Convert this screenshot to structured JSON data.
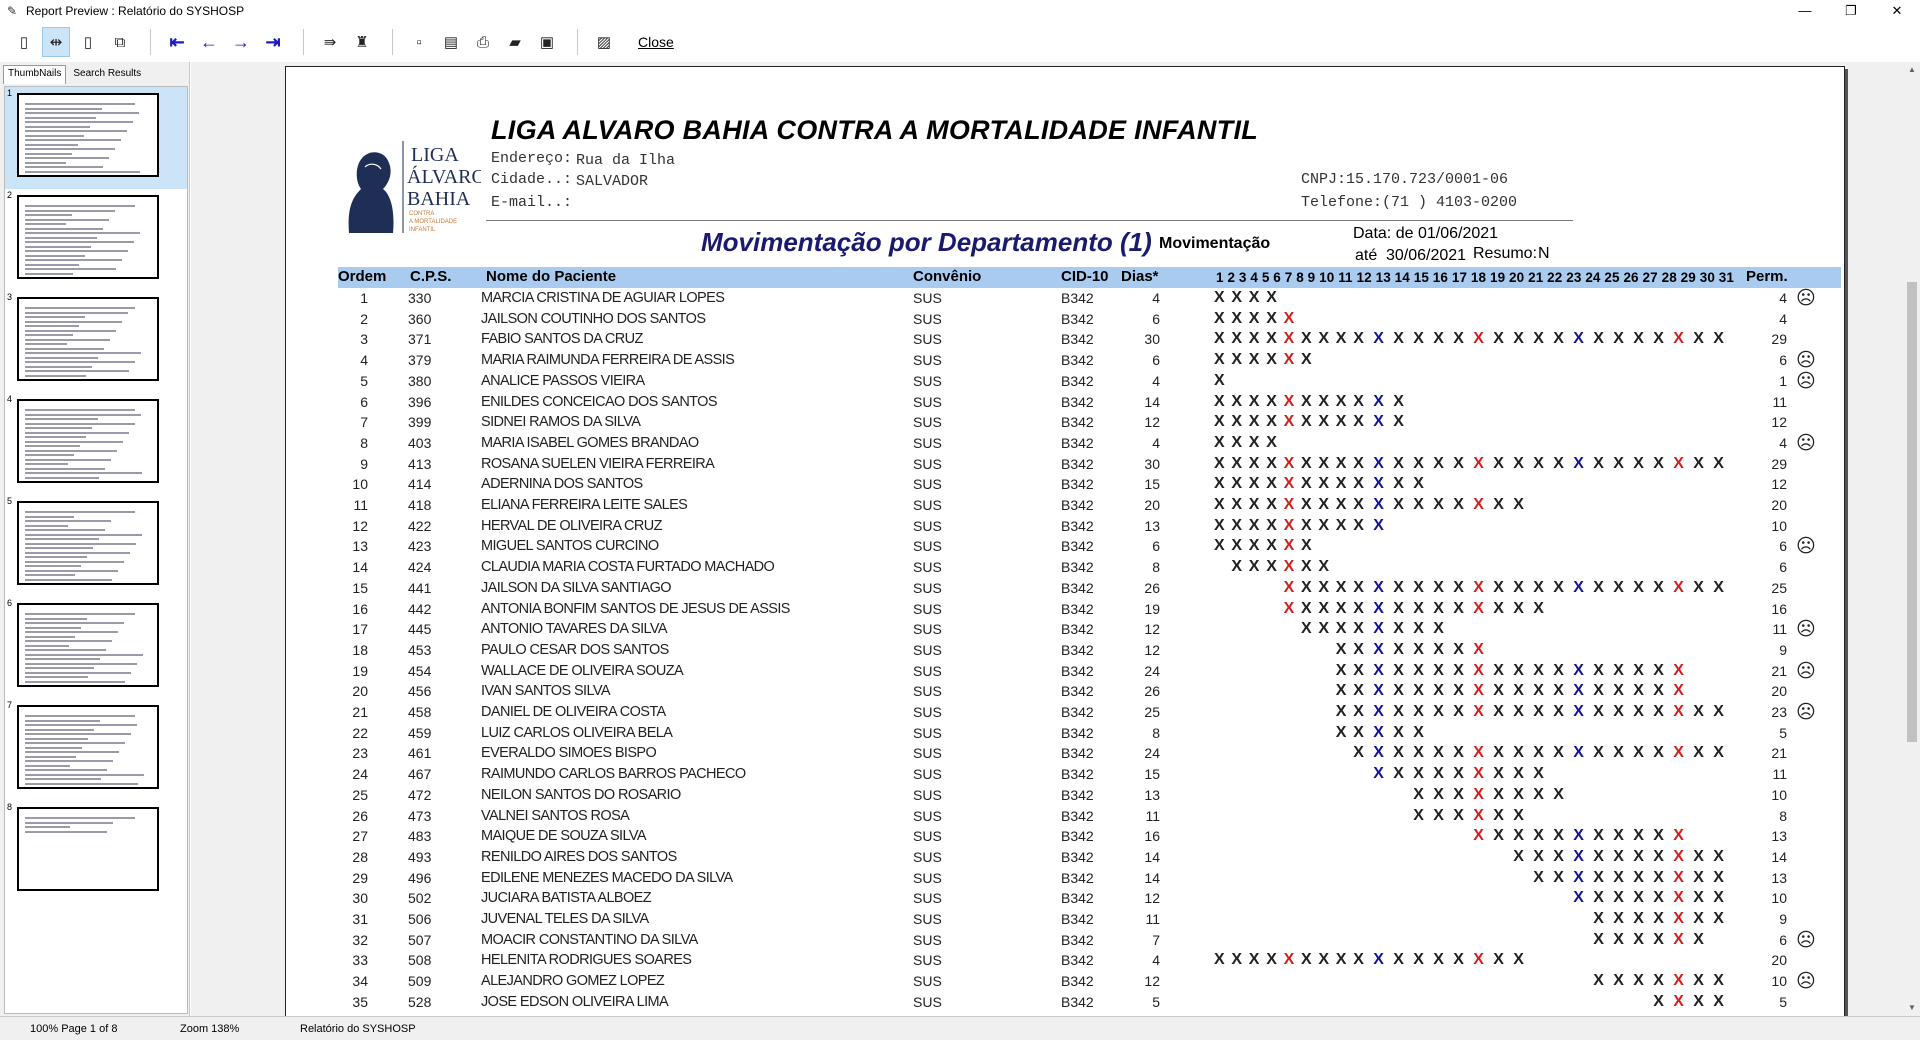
{
  "window": {
    "title": "Report Preview : Relatório do SYSHOSP",
    "controls": [
      "—",
      "❐",
      "✕"
    ]
  },
  "toolbar": {
    "close_label": "Close"
  },
  "left_panel": {
    "tabs": [
      "ThumbNails",
      "Search Results"
    ],
    "thumbnails": [
      "1",
      "2",
      "3",
      "4",
      "5",
      "6",
      "7",
      "8"
    ]
  },
  "report": {
    "org_name": "LIGA ALVARO BAHIA CONTRA A MORTALIDADE INFANTIL",
    "logo_text": [
      "LIGA",
      "ÁLVARO",
      "BAHIA",
      "CONTRA",
      "A MORTALIDADE",
      "INFANTIL"
    ],
    "address_label": "Endereço:",
    "address_value": "Rua da Ilha",
    "city_label": "Cidade..:",
    "city_value": "SALVADOR",
    "email_label": "E-mail..:",
    "cnpj": "CNPJ:15.170.723/0001-06",
    "phone": "Telefone:(71 ) 4103-0200",
    "title": "Movimentação por Departamento (1)",
    "subtitle": "Movimentação",
    "date_from_label": "Data: de",
    "date_from": "01/06/2021",
    "date_to_label": "até",
    "date_to": "30/06/2021",
    "resumo_label": "Resumo:",
    "resumo_value": "N",
    "columns": {
      "ordem": "Ordem",
      "cps": "C.P.S.",
      "nome": "Nome do Paciente",
      "convenio": "Convênio",
      "cid": "CID-10",
      "dias": "Dias*",
      "days": "1 2 3 4 5 6 7 8 9 10 11 12 13 14 15 16 17 18 19 20 21 22 23 24 25 26 27 28 29 30 31",
      "perm": "Perm."
    },
    "rows": [
      {
        "ordem": "1",
        "cps": "330",
        "nome": "MARCIA CRISTINA DE AGUIAR LOPES",
        "convenio": "SUS",
        "cid": "B342",
        "dias": "4",
        "start": 1,
        "end": 4,
        "perm": "4",
        "face": true
      },
      {
        "ordem": "2",
        "cps": "360",
        "nome": "JAILSON COUTINHO DOS SANTOS",
        "convenio": "SUS",
        "cid": "B342",
        "dias": "6",
        "start": 1,
        "end": 5,
        "perm": "4",
        "face": false
      },
      {
        "ordem": "3",
        "cps": "371",
        "nome": "FABIO SANTOS DA CRUZ",
        "convenio": "SUS",
        "cid": "B342",
        "dias": "30",
        "start": 1,
        "end": 27,
        "perm": "29",
        "face": false
      },
      {
        "ordem": "4",
        "cps": "379",
        "nome": "MARIA RAIMUNDA FERREIRA DE ASSIS",
        "convenio": "SUS",
        "cid": "B342",
        "dias": "6",
        "start": 1,
        "end": 6,
        "perm": "6",
        "face": true
      },
      {
        "ordem": "5",
        "cps": "380",
        "nome": "ANALICE PASSOS VIEIRA",
        "convenio": "SUS",
        "cid": "B342",
        "dias": "4",
        "start": 1,
        "end": 1,
        "perm": "1",
        "face": true
      },
      {
        "ordem": "6",
        "cps": "396",
        "nome": "ENILDES CONCEICAO DOS SANTOS",
        "convenio": "SUS",
        "cid": "B342",
        "dias": "14",
        "start": 1,
        "end": 11,
        "perm": "11",
        "face": false
      },
      {
        "ordem": "7",
        "cps": "399",
        "nome": "SIDNEI RAMOS DA SILVA",
        "convenio": "SUS",
        "cid": "B342",
        "dias": "12",
        "start": 1,
        "end": 11,
        "perm": "12",
        "face": false
      },
      {
        "ordem": "8",
        "cps": "403",
        "nome": "MARIA ISABEL GOMES BRANDAO",
        "convenio": "SUS",
        "cid": "B342",
        "dias": "4",
        "start": 1,
        "end": 4,
        "perm": "4",
        "face": true
      },
      {
        "ordem": "9",
        "cps": "413",
        "nome": "ROSANA SUELEN VIEIRA FERREIRA",
        "convenio": "SUS",
        "cid": "B342",
        "dias": "30",
        "start": 1,
        "end": 27,
        "perm": "29",
        "face": false
      },
      {
        "ordem": "10",
        "cps": "414",
        "nome": "ADERNINA DOS SANTOS",
        "convenio": "SUS",
        "cid": "B342",
        "dias": "15",
        "start": 1,
        "end": 12,
        "perm": "12",
        "face": false
      },
      {
        "ordem": "11",
        "cps": "418",
        "nome": "ELIANA FERREIRA LEITE SALES",
        "convenio": "SUS",
        "cid": "B342",
        "dias": "20",
        "start": 1,
        "end": 17,
        "perm": "20",
        "face": false
      },
      {
        "ordem": "12",
        "cps": "422",
        "nome": "HERVAL DE OLIVEIRA CRUZ",
        "convenio": "SUS",
        "cid": "B342",
        "dias": "13",
        "start": 1,
        "end": 10,
        "perm": "10",
        "face": false
      },
      {
        "ordem": "13",
        "cps": "423",
        "nome": "MIGUEL SANTOS CURCINO",
        "convenio": "SUS",
        "cid": "B342",
        "dias": "6",
        "start": 1,
        "end": 6,
        "perm": "6",
        "face": true
      },
      {
        "ordem": "14",
        "cps": "424",
        "nome": "CLAUDIA MARIA COSTA FURTADO MACHADO",
        "convenio": "SUS",
        "cid": "B342",
        "dias": "8",
        "start": 2,
        "end": 7,
        "perm": "6",
        "face": false
      },
      {
        "ordem": "15",
        "cps": "441",
        "nome": "JAILSON DA SILVA SANTIAGO",
        "convenio": "SUS",
        "cid": "B342",
        "dias": "26",
        "start": 5,
        "end": 27,
        "perm": "25",
        "face": false
      },
      {
        "ordem": "16",
        "cps": "442",
        "nome": "ANTONIA BONFIM SANTOS DE JESUS DE ASSIS",
        "convenio": "SUS",
        "cid": "B342",
        "dias": "19",
        "start": 5,
        "end": 18,
        "perm": "16",
        "face": false
      },
      {
        "ordem": "17",
        "cps": "445",
        "nome": "ANTONIO TAVARES DA SILVA",
        "convenio": "SUS",
        "cid": "B342",
        "dias": "12",
        "start": 6,
        "end": 13,
        "perm": "11",
        "face": true
      },
      {
        "ordem": "18",
        "cps": "453",
        "nome": "PAULO CESAR DOS SANTOS",
        "convenio": "SUS",
        "cid": "B342",
        "dias": "12",
        "start": 8,
        "end": 15,
        "perm": "9",
        "face": false
      },
      {
        "ordem": "19",
        "cps": "454",
        "nome": "WALLACE DE OLIVEIRA SOUZA",
        "convenio": "SUS",
        "cid": "B342",
        "dias": "24",
        "start": 8,
        "end": 25,
        "perm": "21",
        "face": true
      },
      {
        "ordem": "20",
        "cps": "456",
        "nome": "IVAN SANTOS SILVA",
        "convenio": "SUS",
        "cid": "B342",
        "dias": "26",
        "start": 8,
        "end": 25,
        "perm": "20",
        "face": false
      },
      {
        "ordem": "21",
        "cps": "458",
        "nome": "DANIEL DE OLIVEIRA COSTA",
        "convenio": "SUS",
        "cid": "B342",
        "dias": "25",
        "start": 8,
        "end": 27,
        "perm": "23",
        "face": true
      },
      {
        "ordem": "22",
        "cps": "459",
        "nome": "LUIZ CARLOS OLIVEIRA BELA",
        "convenio": "SUS",
        "cid": "B342",
        "dias": "8",
        "start": 8,
        "end": 12,
        "perm": "5",
        "face": false
      },
      {
        "ordem": "23",
        "cps": "461",
        "nome": "EVERALDO SIMOES BISPO",
        "convenio": "SUS",
        "cid": "B342",
        "dias": "24",
        "start": 9,
        "end": 27,
        "perm": "21",
        "face": false
      },
      {
        "ordem": "24",
        "cps": "467",
        "nome": "RAIMUNDO CARLOS BARROS PACHECO",
        "convenio": "SUS",
        "cid": "B342",
        "dias": "15",
        "start": 10,
        "end": 18,
        "perm": "11",
        "face": false
      },
      {
        "ordem": "25",
        "cps": "472",
        "nome": "NEILON SANTOS DO ROSARIO",
        "convenio": "SUS",
        "cid": "B342",
        "dias": "13",
        "start": 12,
        "end": 19,
        "perm": "10",
        "face": false
      },
      {
        "ordem": "26",
        "cps": "473",
        "nome": "VALNEI SANTOS ROSA",
        "convenio": "SUS",
        "cid": "B342",
        "dias": "11",
        "start": 12,
        "end": 17,
        "perm": "8",
        "face": false
      },
      {
        "ordem": "27",
        "cps": "483",
        "nome": "MAIQUE DE SOUZA SILVA",
        "convenio": "SUS",
        "cid": "B342",
        "dias": "16",
        "start": 15,
        "end": 25,
        "perm": "13",
        "face": false
      },
      {
        "ordem": "28",
        "cps": "493",
        "nome": "RENILDO AIRES DOS SANTOS",
        "convenio": "SUS",
        "cid": "B342",
        "dias": "14",
        "start": 17,
        "end": 27,
        "perm": "14",
        "face": false
      },
      {
        "ordem": "29",
        "cps": "496",
        "nome": "EDILENE MENEZES MACEDO DA SILVA",
        "convenio": "SUS",
        "cid": "B342",
        "dias": "14",
        "start": 18,
        "end": 27,
        "perm": "13",
        "face": false
      },
      {
        "ordem": "30",
        "cps": "502",
        "nome": "JUCIARA BATISTA ALBOEZ",
        "convenio": "SUS",
        "cid": "B342",
        "dias": "12",
        "start": 20,
        "end": 27,
        "perm": "10",
        "face": false
      },
      {
        "ordem": "31",
        "cps": "506",
        "nome": "JUVENAL TELES DA SILVA",
        "convenio": "SUS",
        "cid": "B342",
        "dias": "11",
        "start": 21,
        "end": 27,
        "perm": "9",
        "face": false
      },
      {
        "ordem": "32",
        "cps": "507",
        "nome": "MOACIR CONSTANTINO DA SILVA",
        "convenio": "SUS",
        "cid": "B342",
        "dias": "7",
        "start": 21,
        "end": 26,
        "perm": "6",
        "face": true
      },
      {
        "ordem": "33",
        "cps": "508",
        "nome": "HELENITA RODRIGUES SOARES",
        "convenio": "SUS",
        "cid": "B342",
        "dias": "4",
        "start": 1,
        "end": 17,
        "perm": "20",
        "face": false
      },
      {
        "ordem": "34",
        "cps": "509",
        "nome": "ALEJANDRO GOMEZ LOPEZ",
        "convenio": "SUS",
        "cid": "B342",
        "dias": "12",
        "start": 21,
        "end": 27,
        "perm": "10",
        "face": true
      },
      {
        "ordem": "35",
        "cps": "528",
        "nome": "JOSE EDSON OLIVEIRA LIMA",
        "convenio": "SUS",
        "cid": "B342",
        "dias": "5",
        "start": 24,
        "end": 27,
        "perm": "5",
        "face": false
      }
    ]
  },
  "statusbar": {
    "zoom_page": "100%  Page 1 of 8",
    "zoom": "Zoom 138%",
    "report_name": "Relatório do SYSHOSP"
  },
  "colors": {
    "header_band": "#a8cbef",
    "mark_red": "#d21e1e",
    "mark_blue": "#141490",
    "title_navy": "#1a1a6e"
  }
}
